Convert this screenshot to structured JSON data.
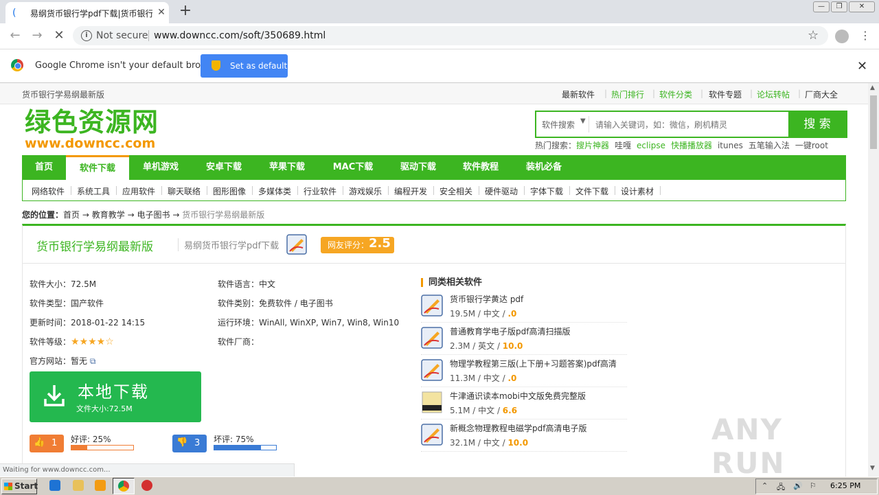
{
  "browser": {
    "tab_title": "易纲货币银行学pdf下载|货币银行学",
    "url": "www.downcc.com/soft/350689.html",
    "security_label": "Not secure",
    "infobar_message": "Google Chrome isn't your default browser",
    "set_default_label": "Set as default",
    "status_text": "Waiting for www.downcc.com..."
  },
  "site": {
    "topbar_title": "货币银行学易纲最新版",
    "top_links": [
      "最新软件",
      "热门排行",
      "软件分类",
      "软件专题",
      "论坛转帖",
      "厂商大全"
    ],
    "logo_cn": "绿色资源网",
    "logo_en": "www.downcc.com",
    "search_category": "软件搜索",
    "search_placeholder": "请输入关键词，如：微信，刷机精灵",
    "search_button": "搜 索",
    "hot_label": "热门搜索：",
    "hot_items": [
      "搜片神器",
      "哇嘎",
      "eclipse",
      "快播播放器",
      "itunes",
      "五笔输入法",
      "一键root"
    ],
    "nav": [
      "首页",
      "软件下载",
      "单机游戏",
      "安卓下载",
      "苹果下载",
      "MAC下载",
      "驱动下载",
      "软件教程",
      "装机必备"
    ],
    "subnav": [
      "网络软件",
      "系统工具",
      "应用软件",
      "聊天联络",
      "图形图像",
      "多媒体类",
      "行业软件",
      "游戏娱乐",
      "编程开发",
      "安全相关",
      "硬件驱动",
      "字体下载",
      "文件下载",
      "设计素材"
    ],
    "breadcrumb": {
      "label": "您的位置：",
      "home": "首页",
      "l1": "教育教学",
      "l2": "电子图书",
      "current": "货币银行学易纲最新版",
      "arrow": "→"
    }
  },
  "software": {
    "title": "货币银行学易纲最新版",
    "subtitle": "易纲货币银行学pdf下载",
    "rating_label": "网友评分：",
    "rating": "2.5",
    "size_label": "软件大小：",
    "size": "72.5M",
    "language_label": "软件语言：",
    "language": "中文",
    "type_label": "软件类型：",
    "type": "国产软件",
    "category_label": "软件类别：",
    "category": "免费软件 / 电子图书",
    "updated_label": "更新时间：",
    "updated": "2018-01-22 14:15",
    "env_label": "运行环境：",
    "env": "WinAll, WinXP, Win7, Win8, Win10",
    "level_label": "软件等级：",
    "level_stars": 4,
    "vendor_label": "软件厂商：",
    "vendor": "",
    "website_label": "官方网站：",
    "website": "暂无",
    "download_label": "本地下载",
    "download_size": "文件大小:72.5M",
    "good_count": "1",
    "good_label": "好评: 25%",
    "good_pct": 25,
    "bad_count": "3",
    "bad_label": "坏评: 75%",
    "bad_pct": 75
  },
  "related": {
    "title": "同类相关软件",
    "items": [
      {
        "name": "货币银行学黄达 pdf",
        "size": "19.5M",
        "lang": "中文",
        "score": ".0"
      },
      {
        "name": "普通教育学电子版pdf高清扫描版",
        "size": "2.3M",
        "lang": "英文",
        "score": "10.0"
      },
      {
        "name": "物理学教程第三版(上下册+习题答案)pdf高清",
        "size": "11.3M",
        "lang": "中文",
        "score": ".0"
      },
      {
        "name": "牛津通识读本mobi中文版免费完整版",
        "size": "5.1M",
        "lang": "中文",
        "score": "6.6"
      },
      {
        "name": "新概念物理教程电磁学pdf高清电子版",
        "size": "32.1M",
        "lang": "中文",
        "score": "10.0"
      }
    ]
  },
  "taskbar": {
    "start_label": "Start",
    "clock": "6:25 PM"
  },
  "watermark": "ANY RUN",
  "colors": {
    "brand_green": "#3cb521",
    "accent_orange": "#f39800",
    "download_green": "#24b84f",
    "chrome_blue": "#4285f4"
  }
}
